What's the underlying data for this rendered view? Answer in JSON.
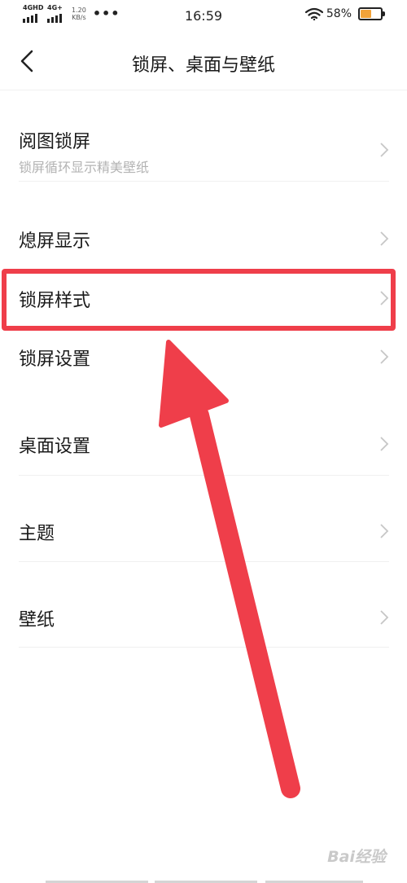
{
  "status_bar": {
    "network_1": "4GHD",
    "network_2": "4G+",
    "speed_value": "1.20",
    "speed_unit": "KB/s",
    "dots": "•••",
    "time": "16:59",
    "battery_percent": "58%",
    "battery_level": 0.58,
    "icons": [
      "signal-icon",
      "wifi-icon",
      "battery-icon"
    ]
  },
  "header": {
    "title": "锁屏、桌面与壁纸",
    "back_icon": "chevron-left-icon"
  },
  "settings": [
    {
      "label": "阅图锁屏",
      "subtitle": "锁屏循环显示精美壁纸"
    },
    {
      "label": "熄屏显示"
    },
    {
      "label": "锁屏样式"
    },
    {
      "label": "锁屏设置"
    },
    {
      "label": "桌面设置"
    },
    {
      "label": "主题"
    },
    {
      "label": "壁纸"
    }
  ],
  "annotation": {
    "color": "#ef3e4a",
    "highlighted_item": "锁屏样式"
  },
  "watermark": "Bai经验"
}
